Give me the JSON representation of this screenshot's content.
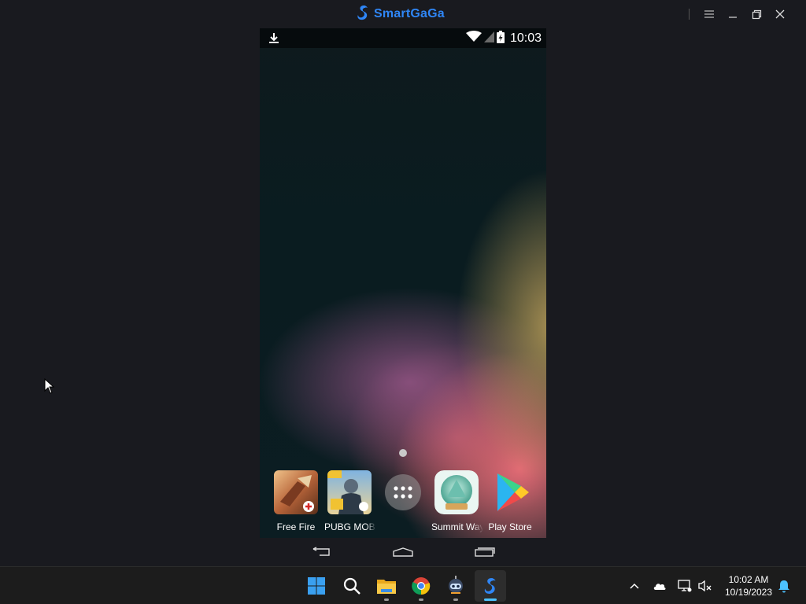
{
  "window": {
    "brand_name": "SmartGaGa",
    "brand_color": "#2f86f6",
    "controls": [
      "menu-icon",
      "minimize-icon",
      "restore-icon",
      "close-icon"
    ]
  },
  "phone": {
    "status_bar": {
      "left_icons": [
        "download-icon"
      ],
      "right_icons": [
        "wifi-icon",
        "cell-signal-icon",
        "battery-charging-icon"
      ],
      "time": "10:03"
    },
    "home_page_indicator": 1,
    "dock": [
      {
        "label": "Free Fire",
        "icon": "free-fire-icon"
      },
      {
        "label": "PUBG MOBILE",
        "icon": "pubg-mobile-icon"
      },
      {
        "label": "",
        "icon": "app-drawer-icon"
      },
      {
        "label": "Summit Way",
        "icon": "summit-way-icon"
      },
      {
        "label": "Play Store",
        "icon": "play-store-icon"
      }
    ],
    "nav_bar": [
      "back-icon",
      "home-icon",
      "recents-icon"
    ]
  },
  "taskbar": {
    "apps": [
      {
        "name": "Start",
        "icon": "windows-start-icon"
      },
      {
        "name": "Search",
        "icon": "search-icon"
      },
      {
        "name": "File Explorer",
        "icon": "file-explorer-icon",
        "running": true
      },
      {
        "name": "Google Chrome",
        "icon": "chrome-icon",
        "running": true
      },
      {
        "name": "Robot app",
        "icon": "robot-app-icon",
        "running": true
      },
      {
        "name": "SmartGaGa",
        "icon": "smartgaga-icon",
        "running": true,
        "active": true
      }
    ],
    "tray": {
      "icons": [
        "chevron-up-icon",
        "onedrive-cloud-icon",
        "network-icon",
        "volume-muted-icon"
      ],
      "time": "10:02 AM",
      "date": "10/19/2023",
      "notification_icon": "bell-icon"
    }
  }
}
